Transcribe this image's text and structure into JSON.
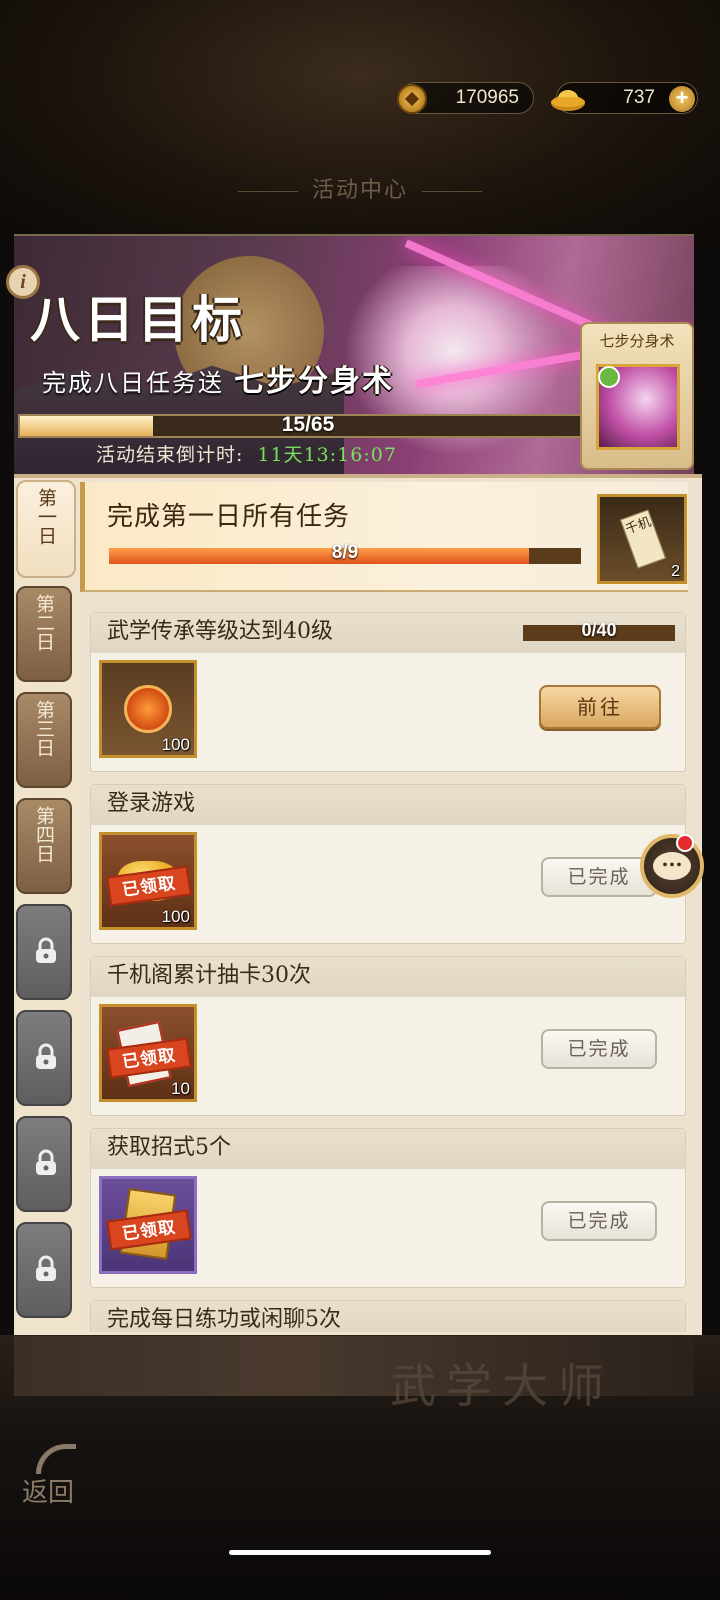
{
  "currency": {
    "coins": "170965",
    "ingots": "737"
  },
  "section_title": "活动中心",
  "banner": {
    "title": "八日目标",
    "subtitle": "完成八日任务送",
    "reward_name": "七步分身术",
    "progress_text": "15/65",
    "progress_fraction": 0.2308,
    "countdown_label": "活动结束倒计时:",
    "countdown_value": "11天13:16:07",
    "reward_card_label": "七步分身术"
  },
  "tabs": [
    {
      "label": "第一日",
      "state": "active"
    },
    {
      "label": "第二日",
      "state": "normal"
    },
    {
      "label": "第三日",
      "state": "normal"
    },
    {
      "label": "第四日",
      "state": "normal"
    },
    {
      "label": "",
      "state": "locked"
    },
    {
      "label": "",
      "state": "locked"
    },
    {
      "label": "",
      "state": "locked"
    },
    {
      "label": "",
      "state": "locked"
    }
  ],
  "day_goal": {
    "title": "完成第一日所有任务",
    "progress_text": "8/9",
    "progress_fraction": 0.889,
    "reward_text": "千机",
    "reward_count": "2"
  },
  "tasks": [
    {
      "title": "武学传承等级达到40级",
      "progress_text": "0/40",
      "item_count": "100",
      "button": "前往",
      "claimed_stamp": ""
    },
    {
      "title": "登录游戏",
      "progress_text": "",
      "item_count": "100",
      "button": "已完成",
      "claimed_stamp": "已领取"
    },
    {
      "title": "千机阁累计抽卡30次",
      "progress_text": "",
      "item_count": "10",
      "button": "已完成",
      "claimed_stamp": "已领取"
    },
    {
      "title": "获取招式5个",
      "progress_text": "",
      "item_count": "",
      "button": "已完成",
      "claimed_stamp": "已领取"
    },
    {
      "title": "完成每日练功或闲聊5次",
      "progress_text": "",
      "item_count": "",
      "button": "",
      "claimed_stamp": ""
    }
  ],
  "footer_title": "武学大师",
  "back_label": "返回",
  "icons": {
    "info": "i",
    "chat": "..."
  }
}
